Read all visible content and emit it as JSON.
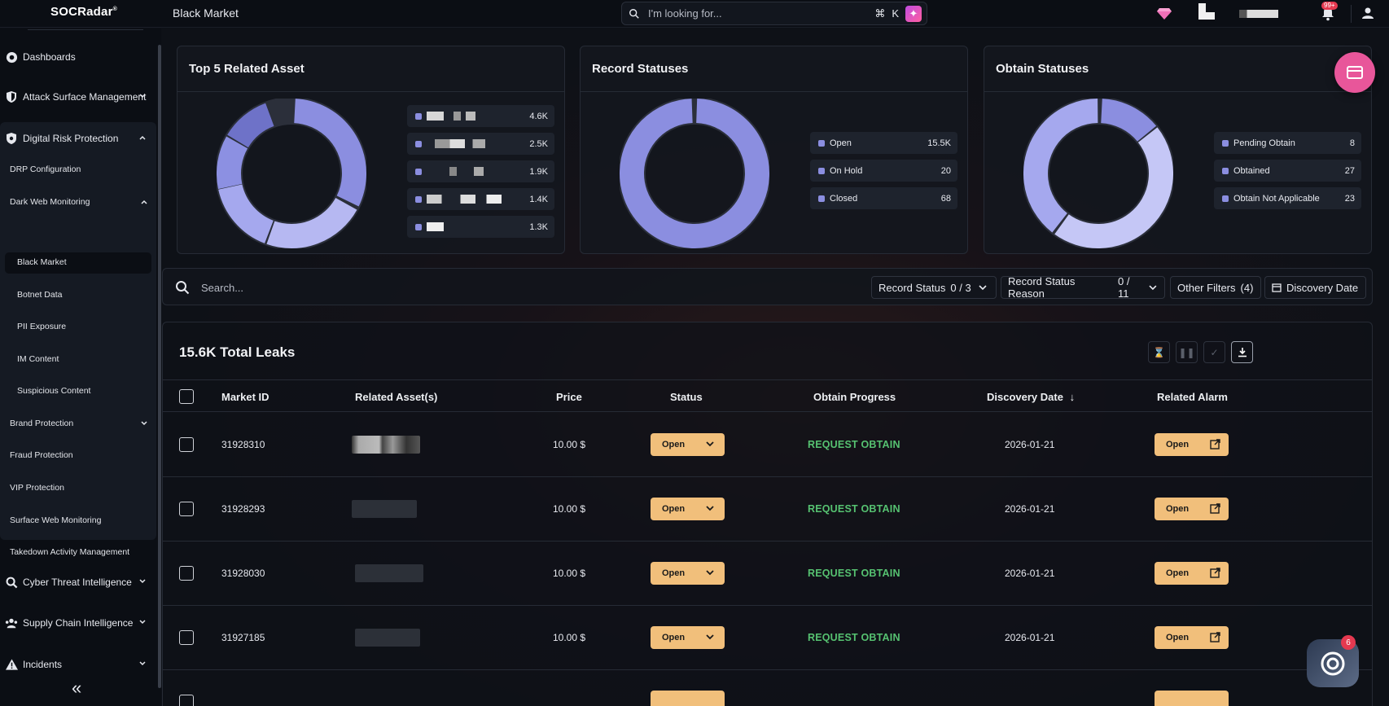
{
  "brand": {
    "name": "SOCRadar",
    "mark": "®"
  },
  "header": {
    "page_title": "Black Market",
    "search_placeholder": "I'm looking for...",
    "shortcut_cmd": "⌘",
    "shortcut_key": "K",
    "notif_badge": "99+"
  },
  "sidebar": {
    "top_items": [
      {
        "label": "Dashboards"
      },
      {
        "label": "Attack Surface Management"
      },
      {
        "label": "Digital Risk Protection"
      }
    ],
    "drp_items": [
      {
        "label": "DRP Configuration"
      },
      {
        "label": "Dark Web Monitoring"
      },
      {
        "label": "Black Market"
      },
      {
        "label": "Botnet Data"
      },
      {
        "label": "PII Exposure"
      },
      {
        "label": "IM Content"
      },
      {
        "label": "Suspicious Content"
      },
      {
        "label": "Brand Protection"
      },
      {
        "label": "Fraud Protection"
      },
      {
        "label": "VIP Protection"
      },
      {
        "label": "Surface Web Monitoring"
      },
      {
        "label": "Takedown Activity Management"
      }
    ],
    "bottom_items": [
      {
        "label": "Cyber Threat Intelligence"
      },
      {
        "label": "Supply Chain Intelligence"
      },
      {
        "label": "Incidents"
      }
    ],
    "collapse_glyph": "«"
  },
  "cards": {
    "top_assets": {
      "title": "Top 5 Related Asset",
      "values": [
        "4.6K",
        "2.5K",
        "1.9K",
        "1.4K",
        "1.3K"
      ]
    },
    "record_statuses": {
      "title": "Record Statuses",
      "items": [
        {
          "label": "Open",
          "value": "15.5K"
        },
        {
          "label": "On Hold",
          "value": "20"
        },
        {
          "label": "Closed",
          "value": "68"
        }
      ]
    },
    "obtain_statuses": {
      "title": "Obtain Statuses",
      "items": [
        {
          "label": "Pending Obtain",
          "value": "8"
        },
        {
          "label": "Obtained",
          "value": "27"
        },
        {
          "label": "Obtain Not Applicable",
          "value": "23"
        }
      ]
    }
  },
  "filters": {
    "search_placeholder": "Search...",
    "record_status_label": "Record Status",
    "record_status_count": "0 / 3",
    "record_status_reason_label": "Record Status Reason",
    "record_status_reason_count": "0 / 11",
    "other_filters_label": "Other Filters",
    "other_filters_count": "(4)",
    "discovery_date_label": "Discovery Date"
  },
  "table": {
    "total_label": "15.6K Total Leaks",
    "columns": [
      "Market ID",
      "Related Asset(s)",
      "Price",
      "Status",
      "Obtain Progress",
      "Discovery Date",
      "Related Alarm"
    ],
    "sort_glyph": "↓",
    "rows": [
      {
        "market_id": "31928310",
        "price": "10.00 $",
        "status": "Open",
        "obtain": "REQUEST OBTAIN",
        "date": "2026-01-21",
        "alarm": "Open"
      },
      {
        "market_id": "31928293",
        "price": "10.00 $",
        "status": "Open",
        "obtain": "REQUEST OBTAIN",
        "date": "2026-01-21",
        "alarm": "Open"
      },
      {
        "market_id": "31928030",
        "price": "10.00 $",
        "status": "Open",
        "obtain": "REQUEST OBTAIN",
        "date": "2026-01-21",
        "alarm": "Open"
      },
      {
        "market_id": "31927185",
        "price": "10.00 $",
        "status": "Open",
        "obtain": "REQUEST OBTAIN",
        "date": "2026-01-21",
        "alarm": "Open"
      }
    ]
  },
  "chat": {
    "badge": "6"
  },
  "colors": {
    "accent_orange": "#f1bf7b",
    "success_green": "#56c271",
    "donut_primary": "#8b8ee0",
    "donut_light": "#b6b8f2",
    "fab_pink": "#e8569a"
  }
}
